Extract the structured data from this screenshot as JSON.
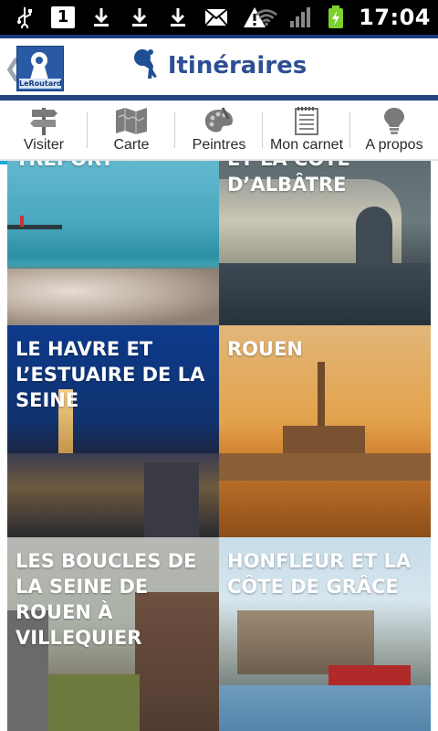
{
  "statusbar": {
    "time": "17:04",
    "notification_count": "1"
  },
  "header": {
    "back_glyph": "❮",
    "logo_text": "LeRoutard",
    "title": "Itinéraires"
  },
  "tabs": [
    {
      "label": "Visiter",
      "icon": "signpost-icon",
      "active": true
    },
    {
      "label": "Carte",
      "icon": "map-icon",
      "active": false
    },
    {
      "label": "Peintres",
      "icon": "palette-icon",
      "active": false
    },
    {
      "label": "Mon carnet",
      "icon": "notepad-icon",
      "active": false
    },
    {
      "label": "A propos",
      "icon": "lightbulb-icon",
      "active": false
    }
  ],
  "tiles": [
    {
      "title": "TRÉPORT"
    },
    {
      "title": "ET LA CÔTE D’ALBÂTRE"
    },
    {
      "title": "LE HAVRE ET L’ESTUAIRE DE LA SEINE"
    },
    {
      "title": "ROUEN"
    },
    {
      "title": "LES BOUCLES DE LA SEINE DE ROUEN À VILLEQUIER"
    },
    {
      "title": "HONFLEUR ET LA CÔTE DE GRÂCE"
    }
  ],
  "colors": {
    "header_blue": "#2e4f93",
    "header_bar": "#25447f",
    "tab_active": "#20a9d8",
    "battery_green": "#7bd12e"
  }
}
